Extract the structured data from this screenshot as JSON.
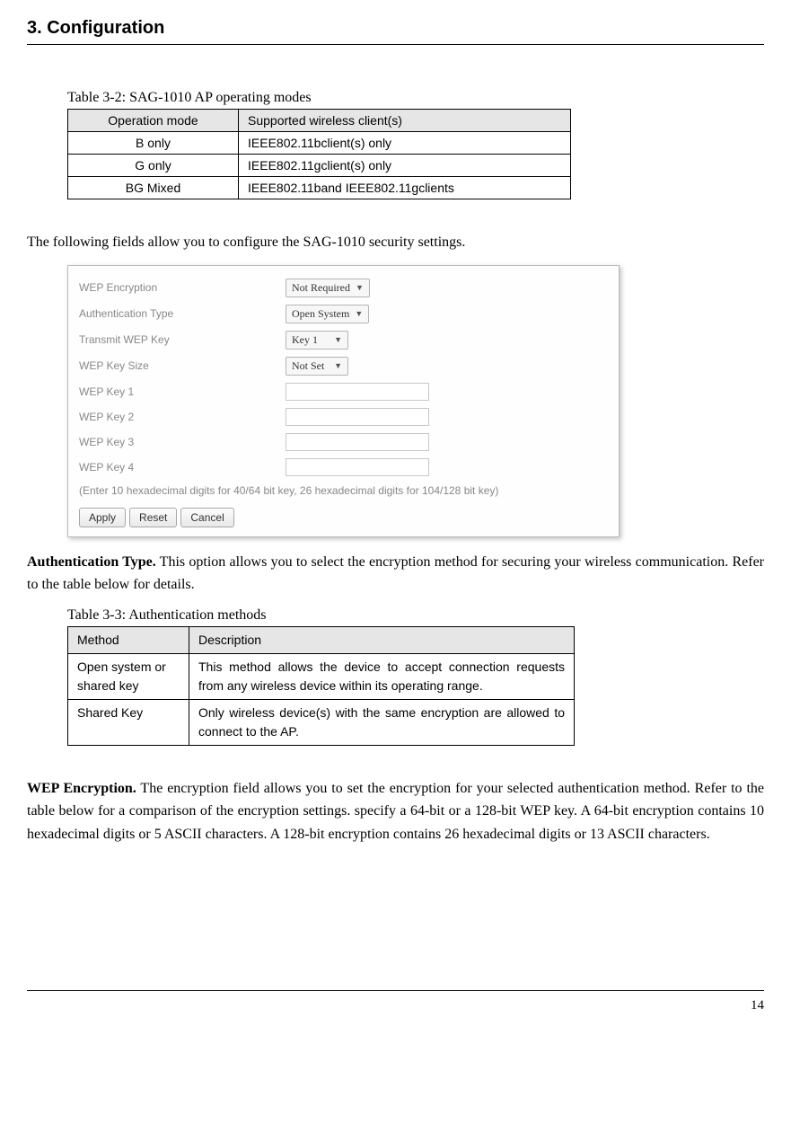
{
  "header": {
    "title": "3. Configuration"
  },
  "table1": {
    "caption": "Table 3-2: SAG-1010 AP operating modes",
    "headers": [
      "Operation mode",
      "Supported wireless client(s)"
    ],
    "rows": [
      [
        "B only",
        "IEEE802.11bclient(s) only"
      ],
      [
        "G only",
        "IEEE802.11gclient(s) only"
      ],
      [
        "BG Mixed",
        "IEEE802.11band IEEE802.11gclients"
      ]
    ]
  },
  "intro_text": "The following fields allow you to configure the SAG-1010 security settings.",
  "form": {
    "fields": [
      {
        "label": "WEP Encryption",
        "type": "select",
        "value": "Not Required"
      },
      {
        "label": "Authentication Type",
        "type": "select",
        "value": "Open System"
      },
      {
        "label": "Transmit WEP Key",
        "type": "select",
        "value": "Key 1"
      },
      {
        "label": "WEP Key Size",
        "type": "select",
        "value": "Not Set"
      },
      {
        "label": "WEP Key 1",
        "type": "input",
        "value": ""
      },
      {
        "label": "WEP Key 2",
        "type": "input",
        "value": ""
      },
      {
        "label": "WEP Key 3",
        "type": "input",
        "value": ""
      },
      {
        "label": "WEP Key 4",
        "type": "input",
        "value": ""
      }
    ],
    "hint": "(Enter 10 hexadecimal digits for 40/64 bit key, 26 hexadecimal digits for 104/128 bit key)",
    "buttons": [
      "Apply",
      "Reset",
      "Cancel"
    ]
  },
  "auth_para": {
    "bold": "Authentication Type.",
    "text": " This option allows you to select the encryption method for securing your wireless communication. Refer to the table below for details."
  },
  "table2": {
    "caption": "Table 3-3: Authentication methods",
    "headers": [
      "Method",
      "Description"
    ],
    "rows": [
      [
        "Open system or shared key",
        "This method allows the device to accept connection requests from any wireless device within its operating range."
      ],
      [
        "Shared Key",
        "Only wireless device(s) with the same encryption are allowed to connect to the AP."
      ]
    ]
  },
  "wep_para": {
    "bold": "WEP Encryption.",
    "text": " The encryption field allows you to set the encryption for your selected authentication method. Refer to the table below for a comparison of the encryption settings. specify a 64-bit or a 128-bit WEP key. A 64-bit encryption contains 10 hexadecimal digits or 5 ASCII characters. A 128-bit encryption contains 26 hexadecimal digits or 13 ASCII characters."
  },
  "page_number": "14"
}
